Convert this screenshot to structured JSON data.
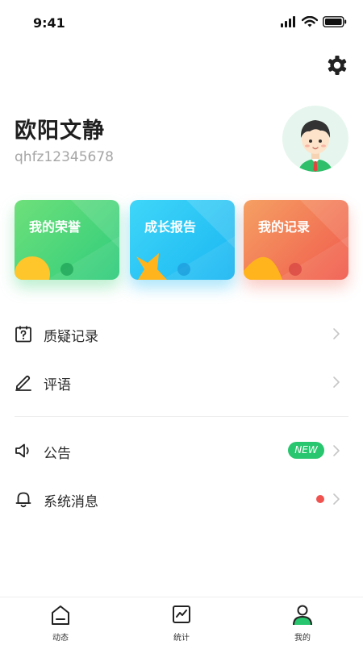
{
  "status_bar": {
    "time": "9:41",
    "icons": [
      "signal-icon",
      "wifi-icon",
      "battery-icon"
    ]
  },
  "header": {
    "settings_icon": "gear-icon"
  },
  "profile": {
    "name": "欧阳文静",
    "id": "qhfz12345678",
    "avatar_icon": "avatar-icon"
  },
  "cards": [
    {
      "title": "我的荣誉",
      "color": "#2fcc7c"
    },
    {
      "title": "成长报告",
      "color": "#1ab6f2"
    },
    {
      "title": "我的记录",
      "color": "#f05a4d"
    }
  ],
  "menu": [
    {
      "label": "质疑记录",
      "icon": "question-calendar-icon"
    },
    {
      "label": "评语",
      "icon": "pen-icon"
    },
    {
      "label": "公告",
      "icon": "speaker-icon",
      "badge": "NEW"
    },
    {
      "label": "系统消息",
      "icon": "bell-icon",
      "dot_color": "#f0524f"
    }
  ],
  "tabbar": {
    "tabs": [
      {
        "label": "动态",
        "icon": "home-icon"
      },
      {
        "label": "统计",
        "icon": "chart-icon"
      },
      {
        "label": "我的",
        "icon": "profile-icon",
        "active": true
      }
    ],
    "active_color": "#28c66e"
  }
}
